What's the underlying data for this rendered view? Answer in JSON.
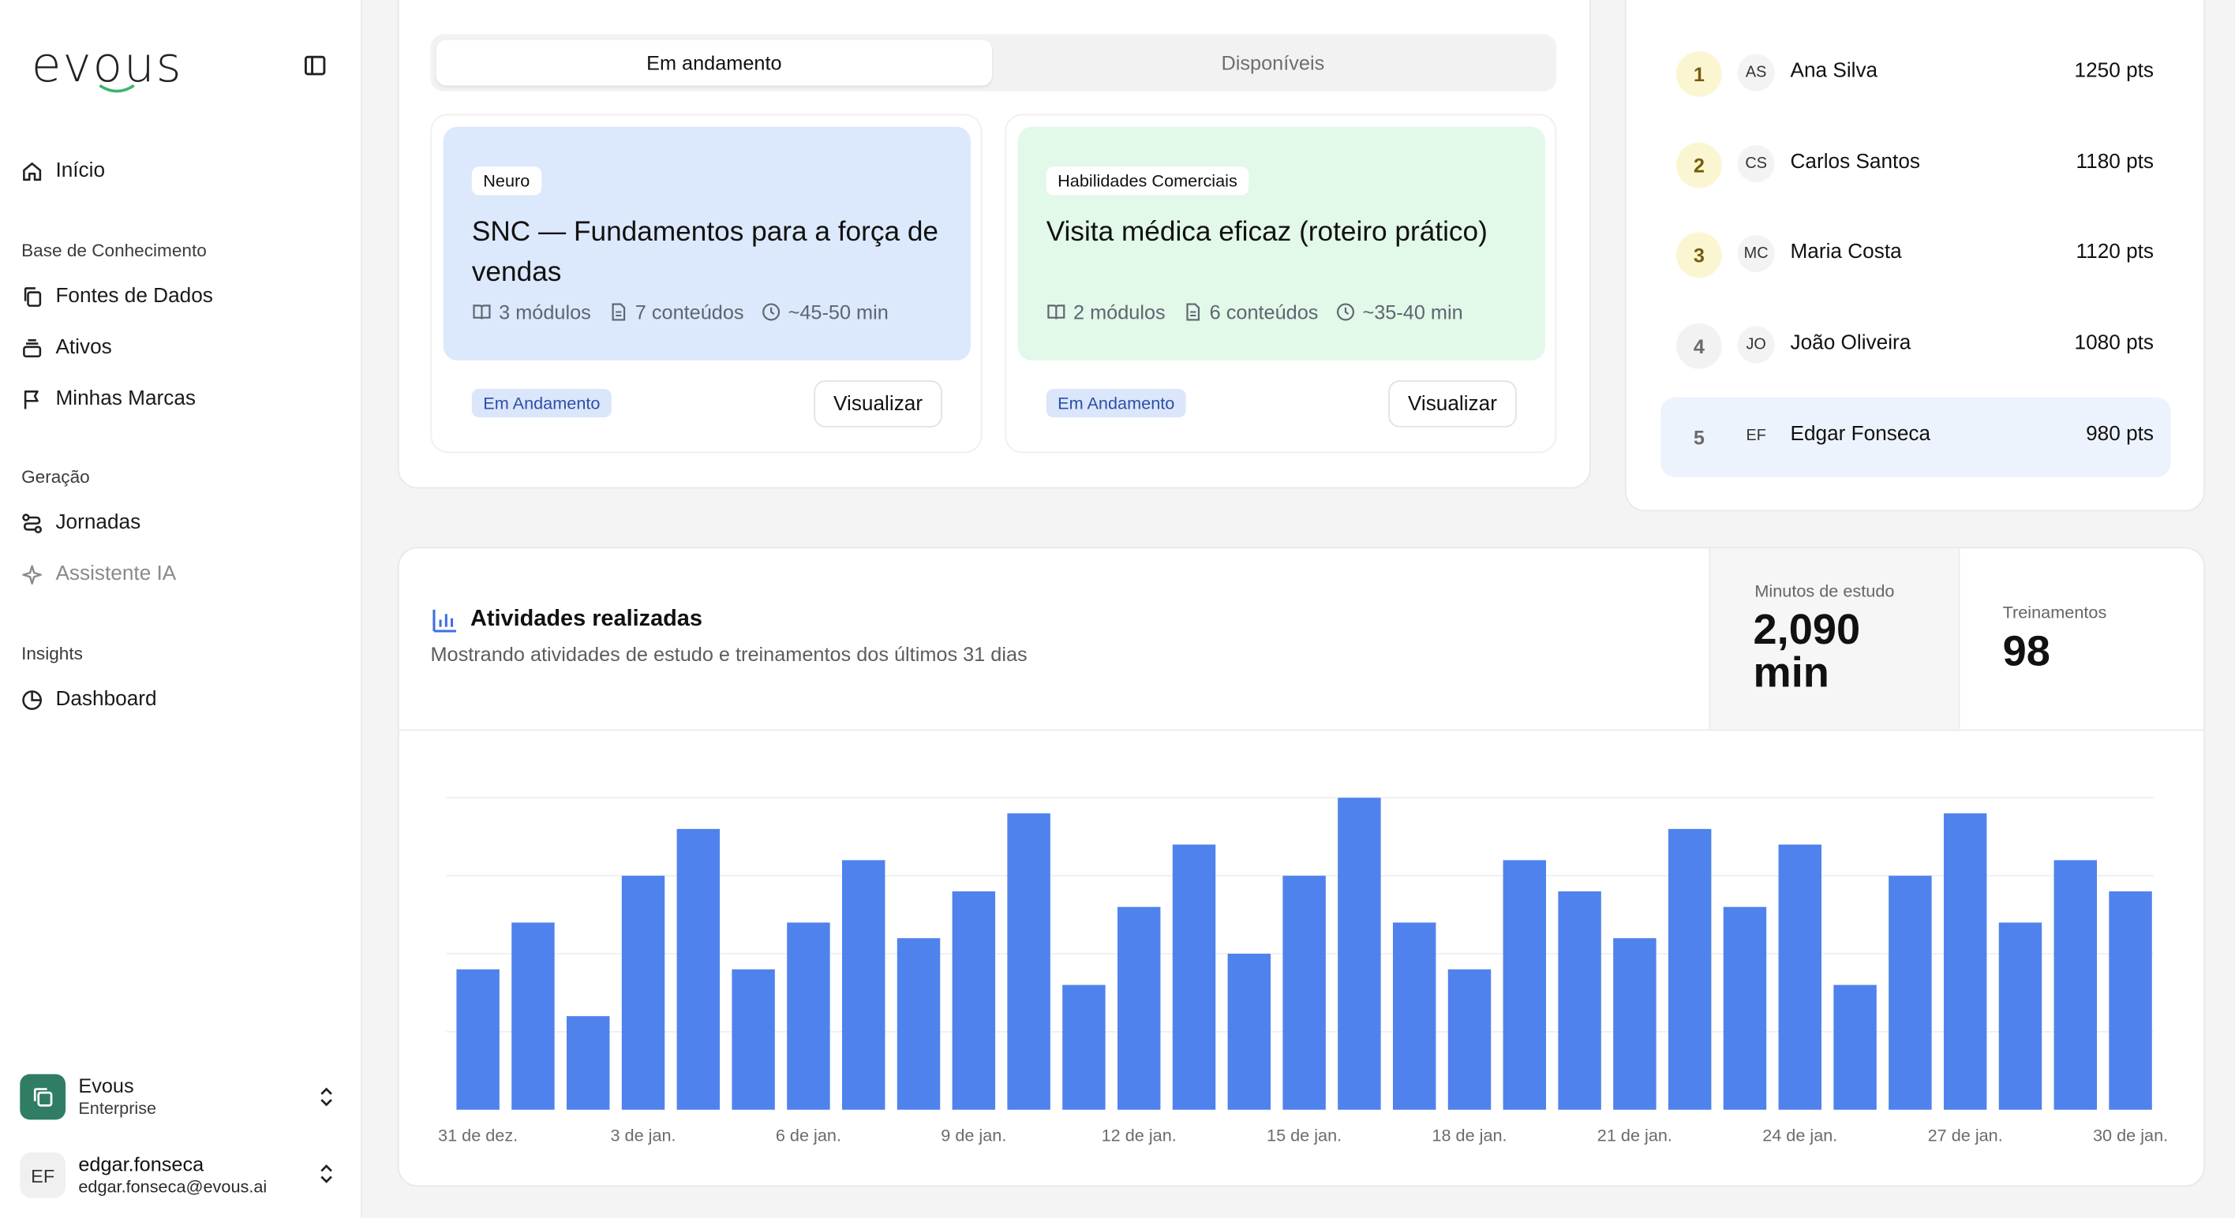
{
  "brand": {
    "name": "evous"
  },
  "sidebar": {
    "nav": {
      "inicio": "Início",
      "kb_label": "Base de Conhecimento",
      "fontes": "Fontes de Dados",
      "ativos": "Ativos",
      "marcas": "Minhas Marcas",
      "gen_label": "Geração",
      "jornadas": "Jornadas",
      "assistente": "Assistente IA",
      "insights_label": "Insights",
      "dashboard": "Dashboard"
    },
    "org": {
      "name": "Evous",
      "plan": "Enterprise"
    },
    "user": {
      "initials": "EF",
      "name": "edgar.fonseca",
      "email": "edgar.fonseca@evous.ai"
    }
  },
  "tabs": {
    "active": "Em andamento",
    "inactive": "Disponíveis"
  },
  "journeys": [
    {
      "tag": "Neuro",
      "title": "SNC — Fundamentos para a força de vendas",
      "modules": "3 módulos",
      "contents": "7 conteúdos",
      "duration": "~45-50 min",
      "status": "Em Andamento",
      "action": "Visualizar",
      "color": "#dce8fb"
    },
    {
      "tag": "Habilidades Comerciais",
      "title": "Visita médica eficaz (roteiro prático)",
      "modules": "2 módulos",
      "contents": "6 conteúdos",
      "duration": "~35-40 min",
      "status": "Em Andamento",
      "action": "Visualizar",
      "color": "#e2f8e8"
    }
  ],
  "leaderboard": [
    {
      "rank": "1",
      "initials": "AS",
      "name": "Ana Silva",
      "points": "1250 pts"
    },
    {
      "rank": "2",
      "initials": "CS",
      "name": "Carlos Santos",
      "points": "1180 pts"
    },
    {
      "rank": "3",
      "initials": "MC",
      "name": "Maria Costa",
      "points": "1120 pts"
    },
    {
      "rank": "4",
      "initials": "JO",
      "name": "João Oliveira",
      "points": "1080 pts"
    },
    {
      "rank": "5",
      "initials": "EF",
      "name": "Edgar Fonseca",
      "points": "980 pts"
    }
  ],
  "activity": {
    "title": "Atividades realizadas",
    "subtitle": "Mostrando atividades de estudo e treinamentos dos últimos 31 dias",
    "stat_minutes_label": "Minutos de estudo",
    "stat_minutes_value": "2,090",
    "stat_minutes_unit": "min",
    "stat_trainings_label": "Treinamentos",
    "stat_trainings_value": "98"
  },
  "chart_data": {
    "type": "bar",
    "categories": [
      "31 de dez.",
      "1 de jan.",
      "2 de jan.",
      "3 de jan.",
      "4 de jan.",
      "5 de jan.",
      "6 de jan.",
      "7 de jan.",
      "8 de jan.",
      "9 de jan.",
      "10 de jan.",
      "11 de jan.",
      "12 de jan.",
      "13 de jan.",
      "14 de jan.",
      "15 de jan.",
      "16 de jan.",
      "17 de jan.",
      "18 de jan.",
      "19 de jan.",
      "20 de jan.",
      "21 de jan.",
      "22 de jan.",
      "23 de jan.",
      "24 de jan.",
      "25 de jan.",
      "26 de jan.",
      "27 de jan.",
      "28 de jan.",
      "29 de jan.",
      "30 de jan."
    ],
    "tick_labels": [
      "31 de dez.",
      "3 de jan.",
      "6 de jan.",
      "9 de jan.",
      "12 de jan.",
      "15 de jan.",
      "18 de jan.",
      "21 de jan.",
      "24 de jan.",
      "27 de jan.",
      "30 de jan."
    ],
    "values": [
      45,
      60,
      30,
      75,
      90,
      45,
      60,
      80,
      55,
      70,
      95,
      40,
      65,
      85,
      50,
      75,
      100,
      60,
      45,
      80,
      70,
      55,
      90,
      65,
      85,
      40,
      75,
      95,
      60,
      80,
      70
    ],
    "ylim": [
      0,
      100
    ],
    "grid": true,
    "color": "#4f82ec"
  }
}
